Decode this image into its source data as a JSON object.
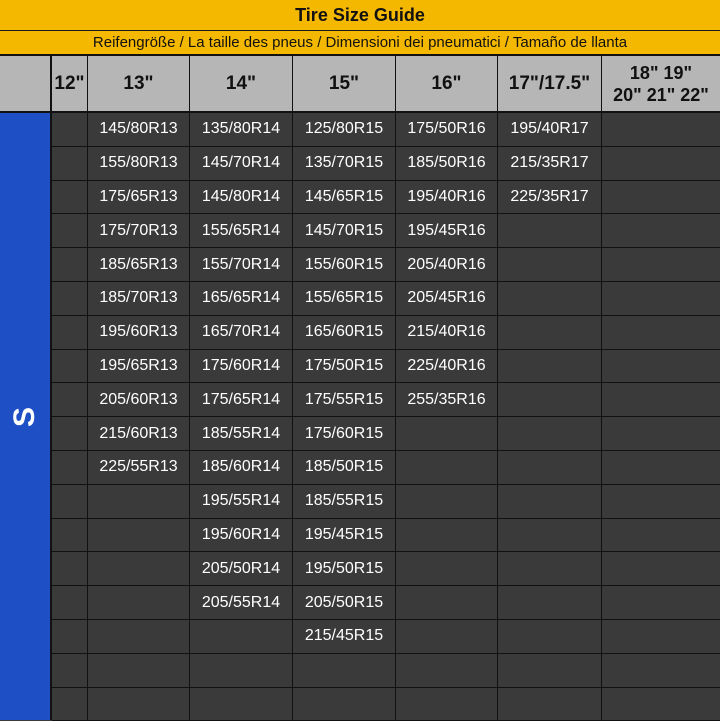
{
  "title": "Tire Size Guide",
  "subtitle": "Reifengröße / La taille des pneus / Dimensioni dei pneumatici / Tamaño de llanta",
  "side_label": "S",
  "columns": [
    "12\"",
    "13\"",
    "14\"",
    "15\"",
    "16\"",
    "17\"/17.5\"",
    "18\"  19\"\n20\" 21\" 22\""
  ],
  "column_sizes": {
    "c12": [],
    "c13": [
      "145/80R13",
      "155/80R13",
      "175/65R13",
      "175/70R13",
      "185/65R13",
      "185/70R13",
      "195/60R13",
      "195/65R13",
      "205/60R13",
      "215/60R13",
      "225/55R13"
    ],
    "c14": [
      "135/80R14",
      "145/70R14",
      "145/80R14",
      "155/65R14",
      "155/70R14",
      "165/65R14",
      "165/70R14",
      "175/60R14",
      "175/65R14",
      "185/55R14",
      "185/60R14",
      "195/55R14",
      "195/60R14",
      "205/50R14",
      "205/55R14"
    ],
    "c15": [
      "125/80R15",
      "135/70R15",
      "145/65R15",
      "145/70R15",
      "155/60R15",
      "155/65R15",
      "165/60R15",
      "175/50R15",
      "175/55R15",
      "175/60R15",
      "185/50R15",
      "185/55R15",
      "195/45R15",
      "195/50R15",
      "205/50R15",
      "215/45R15"
    ],
    "c16": [
      "175/50R16",
      "185/50R16",
      "195/40R16",
      "195/45R16",
      "205/40R16",
      "205/45R16",
      "215/40R16",
      "225/40R16",
      "255/35R16"
    ],
    "c17": [
      "195/40R17",
      "215/35R17",
      "225/35R17"
    ],
    "c18": []
  },
  "colors": {
    "title_bg": "#f5b800",
    "header_bg": "#b6b6b6",
    "side_bg": "#1f4fc4",
    "cell_bg": "#3a3a3a",
    "cell_text": "#ffffff"
  }
}
